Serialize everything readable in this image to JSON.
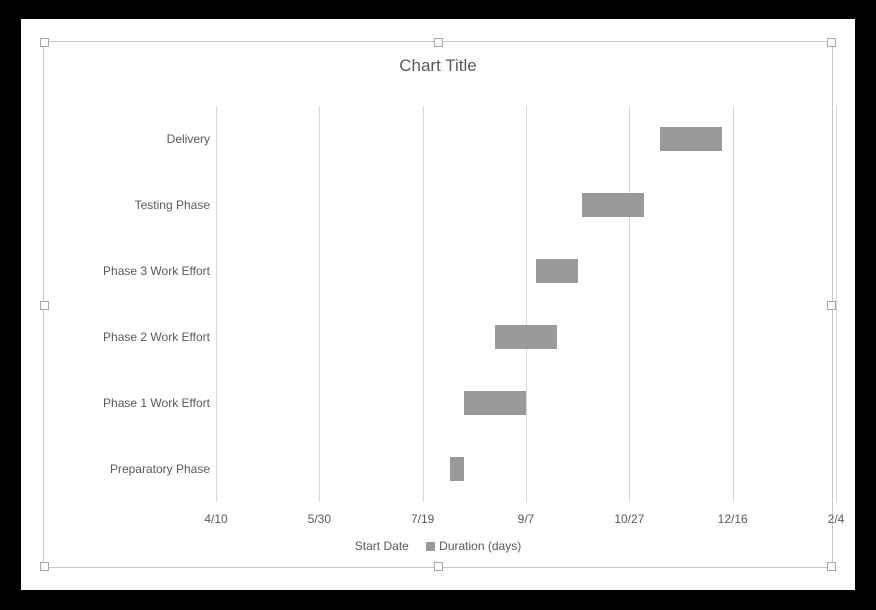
{
  "title": "Chart Title",
  "legend": {
    "series1": "Start Date",
    "series2": "Duration (days)"
  },
  "xaxis": {
    "min": 42470,
    "max": 42770,
    "ticks": [
      {
        "v": 42470,
        "label": "4/10"
      },
      {
        "v": 42520,
        "label": "5/30"
      },
      {
        "v": 42570,
        "label": "7/19"
      },
      {
        "v": 42620,
        "label": "9/7"
      },
      {
        "v": 42670,
        "label": "10/27"
      },
      {
        "v": 42720,
        "label": "12/16"
      },
      {
        "v": 42770,
        "label": "2/4"
      }
    ]
  },
  "tasks": [
    {
      "name": "Preparatory Phase",
      "start": 42583,
      "duration": 7
    },
    {
      "name": "Phase 1 Work Effort",
      "start": 42590,
      "duration": 30
    },
    {
      "name": "Phase 2 Work Effort",
      "start": 42605,
      "duration": 30
    },
    {
      "name": "Phase 3 Work Effort",
      "start": 42625,
      "duration": 20
    },
    {
      "name": "Testing Phase",
      "start": 42647,
      "duration": 30
    },
    {
      "name": "Delivery",
      "start": 42685,
      "duration": 30
    }
  ],
  "chart_data": {
    "type": "bar",
    "orientation": "horizontal",
    "stacked": true,
    "title": "Chart Title",
    "xlabel": "",
    "ylabel": "",
    "x_axis_type": "date",
    "x_ticks": [
      "4/10",
      "5/30",
      "7/19",
      "9/7",
      "10/27",
      "12/16",
      "2/4"
    ],
    "categories": [
      "Preparatory Phase",
      "Phase 1 Work Effort",
      "Phase 2 Work Effort",
      "Phase 3 Work Effort",
      "Testing Phase",
      "Delivery"
    ],
    "series": [
      {
        "name": "Start Date",
        "role": "offset",
        "values": [
          "7/31",
          "8/7",
          "8/22",
          "9/11",
          "10/3",
          "11/10"
        ]
      },
      {
        "name": "Duration (days)",
        "values": [
          7,
          30,
          30,
          20,
          30,
          30
        ]
      }
    ],
    "note": "Gantt-style stacked bar. Start Date serial values (Excel date numbers): 42583,42590,42605,42625,42647,42685. X-axis serial range 42470–42770 (step 50)."
  }
}
